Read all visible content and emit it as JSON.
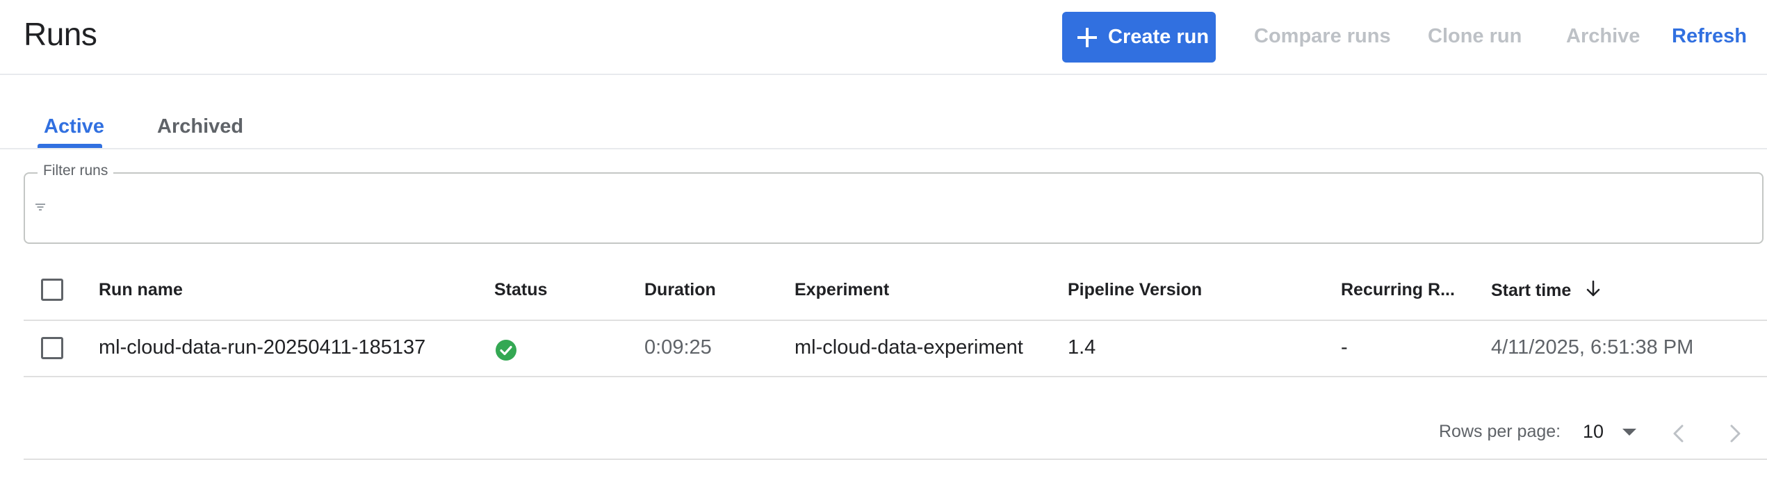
{
  "header": {
    "title": "Runs",
    "create_run_label": "Create run",
    "compare_runs_label": "Compare runs",
    "clone_run_label": "Clone run",
    "archive_label": "Archive",
    "refresh_label": "Refresh"
  },
  "tabs": [
    {
      "label": "Active",
      "selected": true
    },
    {
      "label": "Archived",
      "selected": false
    }
  ],
  "filter": {
    "label": "Filter runs",
    "value": "",
    "icon": "filter-icon"
  },
  "table": {
    "columns": [
      "Run name",
      "Status",
      "Duration",
      "Experiment",
      "Pipeline Version",
      "Recurring R...",
      "Start time"
    ],
    "sort_column": "Start time",
    "sort_direction": "descending",
    "rows": [
      {
        "run_name": "ml-cloud-data-run-20250411-185137",
        "status": "success",
        "duration": "0:09:25",
        "experiment": "ml-cloud-data-experiment",
        "pipeline_version": "1.4",
        "recurring_run": "-",
        "start_time": "4/11/2025, 6:51:38 PM"
      }
    ]
  },
  "pagination": {
    "rows_per_page_label": "Rows per page:",
    "rows_per_page_value": "10"
  },
  "colors": {
    "accent": "#3170e0",
    "disabled": "#bdc1c6",
    "success": "#34a853"
  }
}
